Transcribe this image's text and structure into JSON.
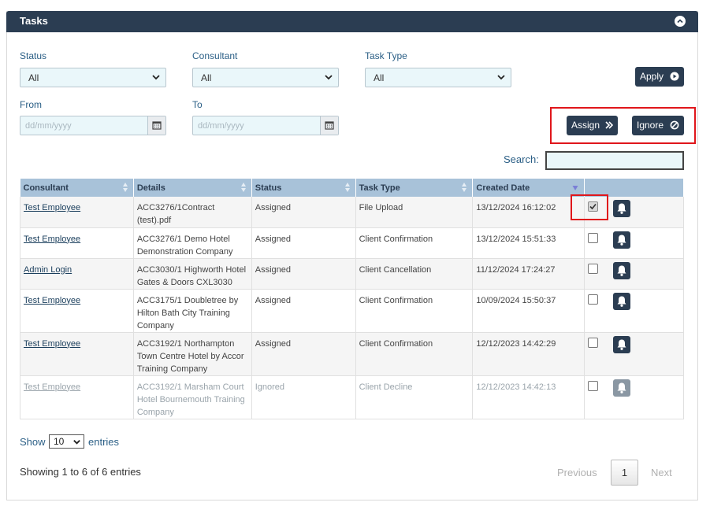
{
  "panel": {
    "title": "Tasks"
  },
  "filters": {
    "status": {
      "label": "Status",
      "value": "All"
    },
    "consultant": {
      "label": "Consultant",
      "value": "All"
    },
    "task_type": {
      "label": "Task Type",
      "value": "All"
    },
    "from": {
      "label": "From",
      "placeholder": "dd/mm/yyyy"
    },
    "to": {
      "label": "To",
      "placeholder": "dd/mm/yyyy"
    }
  },
  "buttons": {
    "apply": "Apply",
    "assign": "Assign",
    "ignore": "Ignore"
  },
  "search": {
    "label": "Search:"
  },
  "table": {
    "headers": [
      "Consultant",
      "Details",
      "Status",
      "Task Type",
      "Created Date"
    ],
    "rows": [
      {
        "consultant": "Test Employee",
        "details": "ACC3276/1Contract (test).pdf",
        "status": "Assigned",
        "type": "File Upload",
        "date": "13/12/2024 16:12:02",
        "checked": true
      },
      {
        "consultant": "Test Employee",
        "details": "ACC3276/1 Demo Hotel Demonstration Company",
        "status": "Assigned",
        "type": "Client Confirmation",
        "date": "13/12/2024 15:51:33",
        "checked": false
      },
      {
        "consultant": "Admin Login",
        "details": "ACC3030/1 Highworth Hotel Gates & Doors CXL3030",
        "status": "Assigned",
        "type": "Client Cancellation",
        "date": "11/12/2024 17:24:27",
        "checked": false
      },
      {
        "consultant": "Test Employee",
        "details": "ACC3175/1 Doubletree by Hilton Bath City Training Company",
        "status": "Assigned",
        "type": "Client Confirmation",
        "date": "10/09/2024 15:50:37",
        "checked": false
      },
      {
        "consultant": "Test Employee",
        "details": "ACC3192/1 Northampton Town Centre Hotel by Accor Training Company",
        "status": "Assigned",
        "type": "Client Confirmation",
        "date": "12/12/2023 14:42:29",
        "checked": false
      },
      {
        "consultant": "Test Employee",
        "details": "ACC3192/1 Marsham Court Hotel Bournemouth Training Company",
        "status": "Ignored",
        "type": "Client Decline",
        "date": "12/12/2023 14:42:13",
        "checked": false
      }
    ]
  },
  "length": {
    "show": "Show",
    "value": "10",
    "entries": "entries"
  },
  "info": "Showing 1 to 6 of 6 entries",
  "pagination": {
    "previous": "Previous",
    "current": "1",
    "next": "Next"
  },
  "colors": {
    "header": "#2b3d52",
    "th": "#a8c2d9",
    "highlight": "#e0161b"
  }
}
